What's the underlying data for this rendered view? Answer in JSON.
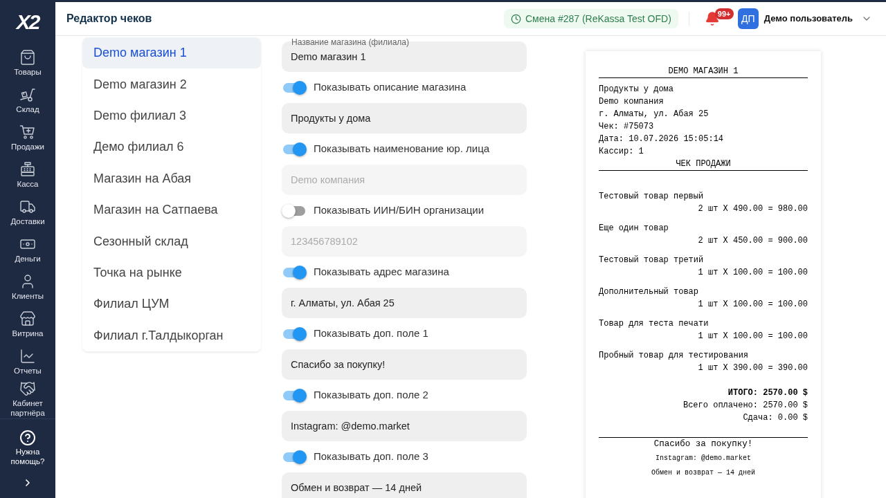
{
  "sidebar": {
    "logo": "X2",
    "items": [
      {
        "label": "Товары"
      },
      {
        "label": "Склад"
      },
      {
        "label": "Продажи"
      },
      {
        "label": "Касса"
      },
      {
        "label": "Доставки"
      },
      {
        "label": "Деньги"
      },
      {
        "label": "Клиенты"
      },
      {
        "label": "Витрина"
      },
      {
        "label": "Отчеты"
      },
      {
        "label": "Кабинет партнёра"
      }
    ],
    "help": "Нужна помощь?"
  },
  "header": {
    "title": "Редактор чеков",
    "shift": "Смена #287 (ReKassa Test OFD)",
    "notification_count": "99+",
    "user": {
      "initials": "ДП",
      "name": "Демо пользователь"
    }
  },
  "stores": [
    {
      "name": "Demo магазин 1",
      "selected": true
    },
    {
      "name": "Demo магазин 2",
      "selected": false
    },
    {
      "name": "Demo филиал 3",
      "selected": false
    },
    {
      "name": "Демо филиал 6",
      "selected": false
    },
    {
      "name": "Магазин на Абая",
      "selected": false
    },
    {
      "name": "Магазин на Сатпаева",
      "selected": false
    },
    {
      "name": "Сезонный склад",
      "selected": false
    },
    {
      "name": "Точка на рынке",
      "selected": false
    },
    {
      "name": "Филиал ЦУМ",
      "selected": false
    },
    {
      "name": "Филиал г.Талдыкорган",
      "selected": false
    }
  ],
  "form": [
    {
      "kind": "field",
      "label": "Название магазина (филиала)",
      "value": "Demo магазин 1"
    },
    {
      "kind": "toggle",
      "label": "Показывать описание магазина",
      "on": true
    },
    {
      "kind": "field",
      "value": "Продукты у дома"
    },
    {
      "kind": "toggle",
      "label": "Показывать наименование юр. лица",
      "on": true
    },
    {
      "kind": "field",
      "placeholder": "Demo компания"
    },
    {
      "kind": "toggle",
      "label": "Показывать ИИН/БИН организации",
      "on": false
    },
    {
      "kind": "field",
      "placeholder": "123456789102"
    },
    {
      "kind": "toggle",
      "label": "Показывать адрес магазина",
      "on": true
    },
    {
      "kind": "field",
      "value": "г. Алматы, ул. Абая 25"
    },
    {
      "kind": "toggle",
      "label": "Показывать доп. поле 1",
      "on": true
    },
    {
      "kind": "field",
      "value": "Спасибо за покупку!"
    },
    {
      "kind": "toggle",
      "label": "Показывать доп. поле 2",
      "on": true
    },
    {
      "kind": "field",
      "value": "Instagram: @demo.market"
    },
    {
      "kind": "toggle",
      "label": "Показывать доп. поле 3",
      "on": true
    },
    {
      "kind": "field",
      "value": "Обмен и возврат — 14 дней"
    }
  ],
  "receipt": {
    "title": "DEMO МАГАЗИН 1",
    "lines": [
      "Продукты у дома",
      "Demo компания",
      "г. Алматы, ул. Абая 25",
      "Чек: #75073",
      "Дата: 10.07.2026 15:05:14",
      "Кассир: 1"
    ],
    "doc_type": "ЧЕК ПРОДАЖИ",
    "items": [
      {
        "name": "Тестовый товар первый",
        "amount": "2 шт X 490.00 = 980.00"
      },
      {
        "name": "Еще один товар",
        "amount": "2 шт X 450.00 = 900.00"
      },
      {
        "name": "Тестовый товар третий",
        "amount": "1 шт X 100.00 = 100.00"
      },
      {
        "name": "Дополнительный товар",
        "amount": "1 шт X 100.00 = 100.00"
      },
      {
        "name": "Товар для теста печати",
        "amount": "1 шт X 100.00 = 100.00"
      },
      {
        "name": "Пробный товар для тестирования",
        "amount": "1 шт X 390.00 = 390.00"
      }
    ],
    "total": "ИТОГО: 2570.00 $",
    "payments": [
      "Всего оплачено: 2570.00 $",
      "Сдача: 0.00 $"
    ],
    "thanks": "Спасибо за покупку!",
    "notes": [
      "Instagram: @demo.market",
      "Обмен и возврат — 14 дней"
    ]
  }
}
